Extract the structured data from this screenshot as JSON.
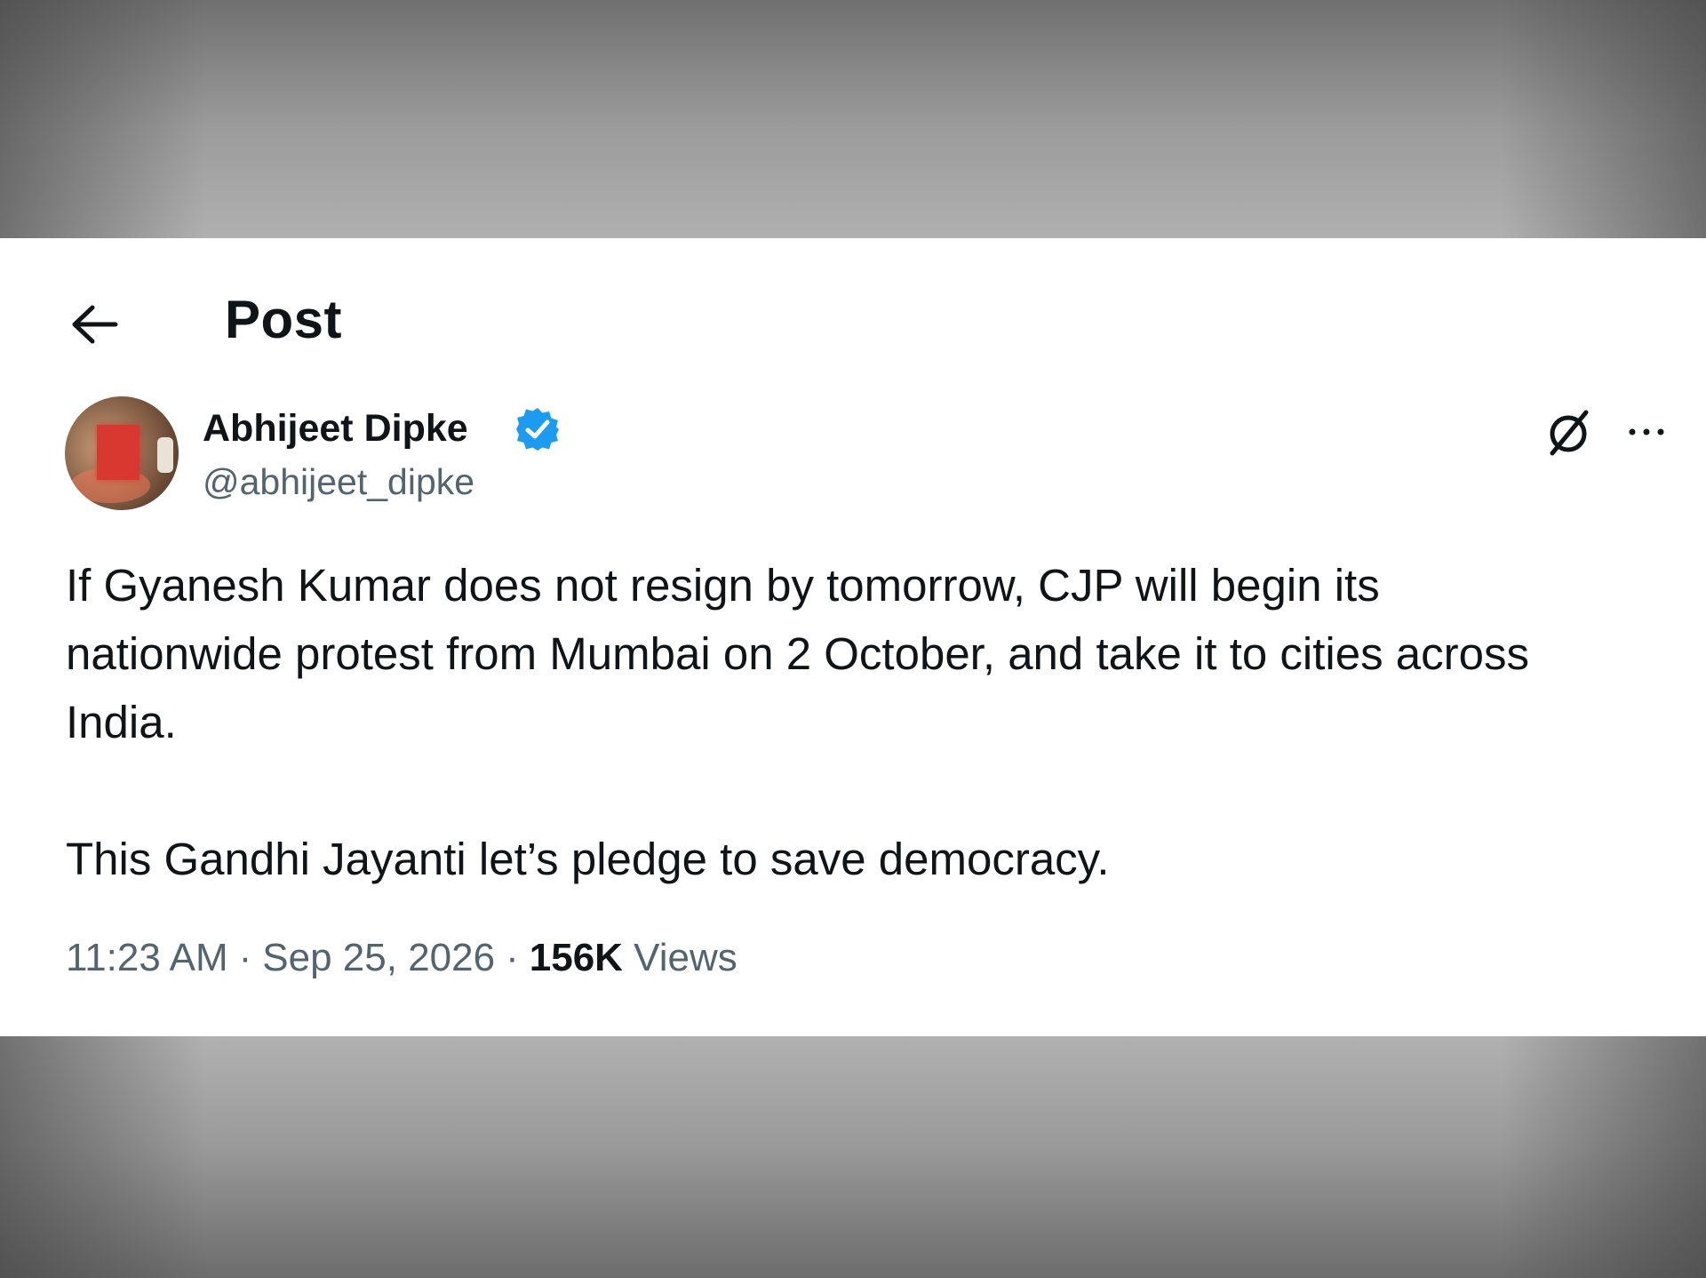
{
  "header": {
    "title": "Post",
    "back_icon": "arrow-left-icon"
  },
  "author": {
    "display_name": "Abhijeet Dipke",
    "handle": "@abhijeet_dipke",
    "verified": true,
    "verified_color": "#1d9bf0"
  },
  "actions": {
    "grok_icon": "grok-icon",
    "more_icon": "more-horizontal-icon"
  },
  "tweet": {
    "paragraphs": [
      "If Gyanesh Kumar does not resign by tomorrow, CJP will begin its nationwide protest from Mumbai on 2 October, and take it to cities across India.",
      "This Gandhi Jayanti let’s pledge to save democracy."
    ]
  },
  "meta": {
    "time": "11:23 AM",
    "separator": "·",
    "date": "Sep 25, 2026",
    "views_count": "156K",
    "views_label": "Views"
  }
}
